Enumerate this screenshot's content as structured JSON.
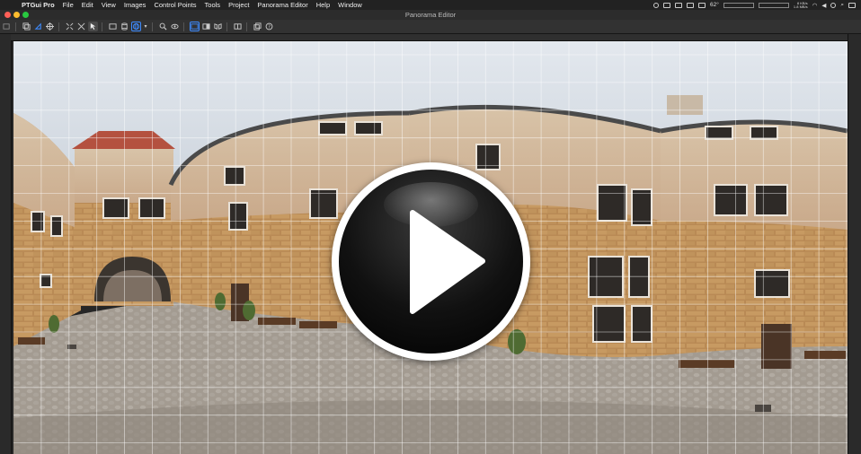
{
  "menubar": {
    "app_name": "PTGui Pro",
    "items": [
      "File",
      "Edit",
      "View",
      "Images",
      "Control Points",
      "Tools",
      "Project",
      "Panorama Editor",
      "Help",
      "Window"
    ],
    "temperature": "62°",
    "net_up": "8 KB/s",
    "net_down": "1.8 MB/s"
  },
  "window": {
    "title": "Panorama Editor"
  },
  "toolbar": {
    "buttons": [
      "edit-icon",
      "rotate-icon",
      "move-icon",
      "center-icon",
      "fit-icon",
      "level-icon",
      "cursor-icon",
      "rectilinear-icon",
      "cylindrical-icon",
      "equirectangular-icon",
      "dropdown-icon",
      "zoom-icon",
      "preview-icon",
      "crop-icon",
      "numeric-icon",
      "mirror-icon",
      "split-icon",
      "layers-icon",
      "help-icon"
    ],
    "accent_color": "#3d8bff"
  },
  "overlay": {
    "play_button": "play-icon"
  }
}
